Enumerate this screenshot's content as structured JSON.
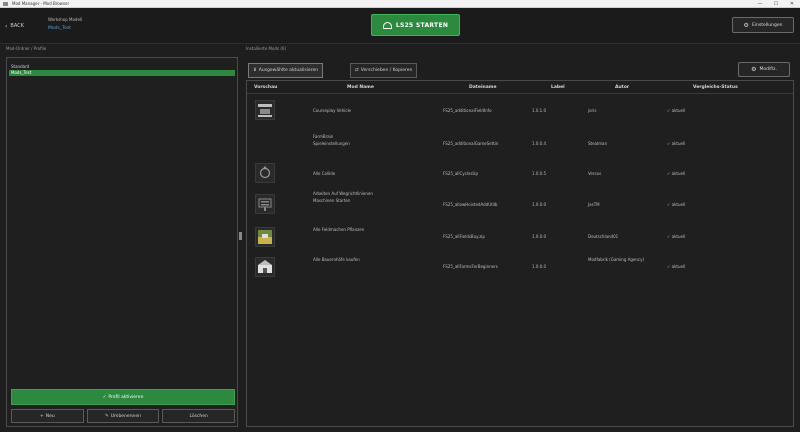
{
  "window": {
    "title": "Mod Manager - Mod Browser",
    "minimize": "—",
    "maximize": "☐",
    "close": "✕"
  },
  "header": {
    "back_label": "BACK",
    "game_name": "Workshop Modell",
    "profile_name": "Mods_Test",
    "launch_label": "LS25 STARTEN",
    "settings_label": "Einstellungen"
  },
  "left": {
    "section_label": "Mod-Ordner / Profile",
    "profiles": [
      {
        "label": "Standard",
        "active": false
      },
      {
        "label": "Mods_Test",
        "active": true
      }
    ],
    "activate_label": "Profil aktivieren",
    "new_label": "Neu",
    "rename_label": "Umbenennen",
    "delete_label": "Löschen"
  },
  "right": {
    "section_label": "Installierte Mods (6)",
    "tabs": [
      {
        "label": "Ausgewählte aktualisieren",
        "icon": "download-icon"
      },
      {
        "label": "Verschieben / Kopieren",
        "icon": "move-icon"
      }
    ],
    "modify_label": "Modifiz.",
    "columns": {
      "preview": "Vorschau",
      "mod_name": "Mod Name",
      "file_name": "Dateiname",
      "version": "Label",
      "author": "Autor",
      "status": "Vergleichs-Status"
    },
    "rows": [
      {
        "name": "Courseplay Vehicle",
        "file": "FS25_additionalFieldInfo",
        "version": "1.0.1.0",
        "author": "joris",
        "status": "✓ aktuell",
        "thumb": "logo-thumb"
      },
      {
        "name": "FarmBrain Spieleinstellungen",
        "file": "FS25_additionalGameSettin",
        "version": "1.0.0.4",
        "author": "Stealman",
        "status": "✓ aktuell",
        "thumb": "none"
      },
      {
        "name": "Alle Collide",
        "file": "FS25_allCyclesUp",
        "version": "1.0.0.5",
        "author": "Versos",
        "status": "✓ aktuell",
        "thumb": "arrow-thumb"
      },
      {
        "name": "Arbeiten Auf Wegrichtlinienen Maschinen Starten",
        "file": "FS25_allowHoistedAddUtilb",
        "version": "1.0.0.0",
        "author": "JasTM",
        "status": "✓ aktuell",
        "thumb": "sign-thumb"
      },
      {
        "name": "Alle Feldmachen Pflanzen",
        "file": "FS25_allFieldsBuy.zip",
        "version": "1.0.0.0",
        "author": "Deutschland01",
        "status": "✓ aktuell",
        "thumb": "field-thumb"
      },
      {
        "name": "Alle Bauernhöfe kaufen",
        "file": "FS25_allFarmsForBeginners",
        "version": "1.0.0.0",
        "author": "Modfabrik (Gaming Agency)",
        "status": "✓ aktuell",
        "thumb": "farm-thumb"
      }
    ]
  },
  "colors": {
    "accent": "#2b8a3e",
    "link": "#4fa3e0",
    "background": "#1e1e1e"
  }
}
